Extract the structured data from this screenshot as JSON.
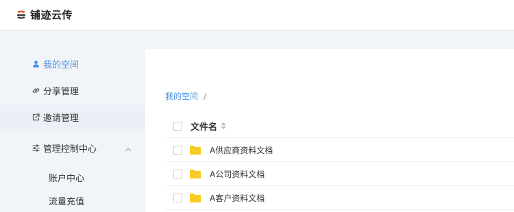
{
  "app": {
    "brand": "铺迹云传"
  },
  "sidebar": {
    "items": [
      {
        "label": "我的空间",
        "icon": "user-icon"
      },
      {
        "label": "分享管理",
        "icon": "link-icon"
      },
      {
        "label": "邀请管理",
        "icon": "external-link-icon"
      },
      {
        "label": "管理控制中心",
        "icon": "sliders-icon"
      }
    ],
    "sub_items": [
      {
        "label": "账户中心"
      },
      {
        "label": "流量充值"
      }
    ]
  },
  "breadcrumb": {
    "root": "我的空间",
    "separator": "/"
  },
  "table": {
    "column_name": "文件名",
    "rows": [
      {
        "name": "A供应商资料文档"
      },
      {
        "name": "A公司资料文档"
      },
      {
        "name": "A客户资料文档"
      }
    ]
  },
  "colors": {
    "accent": "#4a90e2",
    "folder": "#f7cb22",
    "brand_logo": "#e4572e"
  }
}
